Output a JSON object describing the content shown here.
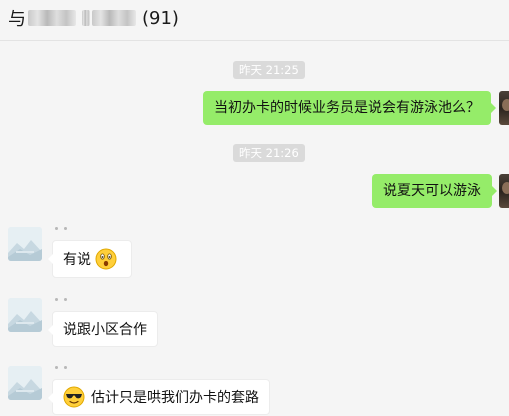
{
  "header": {
    "title_prefix": "与",
    "count": "(91)"
  },
  "messages": [
    {
      "type": "timestamp",
      "text": "昨天 21:25"
    },
    {
      "type": "outgoing",
      "text": "当初办卡的时候业务员是说会有游泳池么？"
    },
    {
      "type": "timestamp",
      "text": "昨天 21:26"
    },
    {
      "type": "outgoing",
      "text": "说夏天可以游泳"
    },
    {
      "type": "incoming",
      "text": "有说",
      "emoji": "surprised-emoji"
    },
    {
      "type": "incoming",
      "text": "说跟小区合作"
    },
    {
      "type": "incoming",
      "text": "估计只是哄我们办卡的套路",
      "emoji": "cool-sunglasses-emoji"
    }
  ],
  "colors": {
    "outgoing_bubble": "#95ec69",
    "incoming_bubble": "#ffffff",
    "background": "#f5f5f5",
    "timestamp_bg": "#dadada"
  }
}
